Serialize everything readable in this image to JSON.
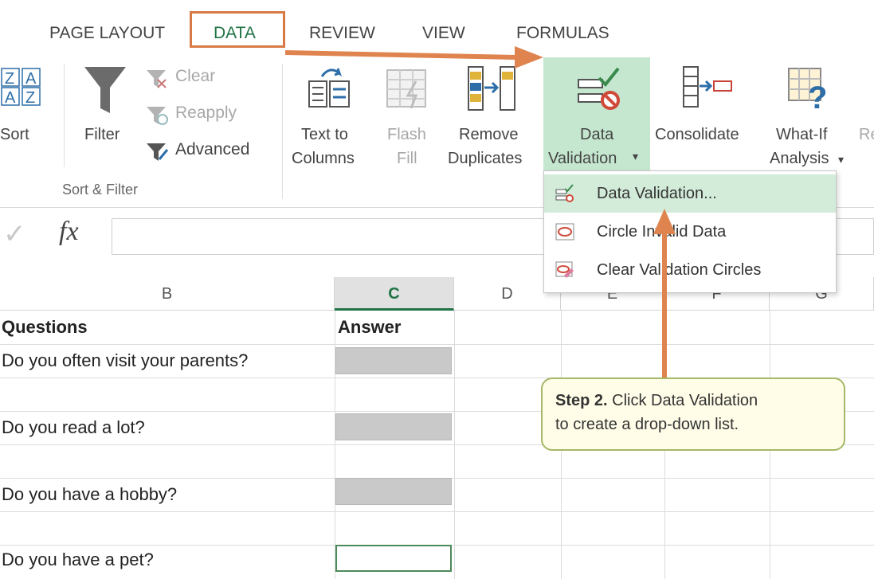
{
  "tabs": [
    "PAGE LAYOUT",
    "DATA",
    "REVIEW",
    "VIEW",
    "FORMULAS"
  ],
  "ribbon": {
    "sort_label": "Sort",
    "filter_label": "Filter",
    "clear_label": "Clear",
    "reapply_label": "Reapply",
    "advanced_label": "Advanced",
    "group_sort_filter": "Sort & Filter",
    "text_to_columns_1": "Text to",
    "text_to_columns_2": "Columns",
    "flash_fill_1": "Flash",
    "flash_fill_2": "Fill",
    "remove_duplicates_1": "Remove",
    "remove_duplicates_2": "Duplicates",
    "data_validation_1": "Data",
    "data_validation_2": "Validation",
    "dropdown_caret": "▾",
    "consolidate": "Consolidate",
    "what_if_1": "What-If",
    "what_if_2": "Analysis",
    "cut_off": "Re"
  },
  "formula_bar": {
    "fx": "fx",
    "check": "✓"
  },
  "columns": [
    "B",
    "C",
    "D",
    "E",
    "F",
    "G"
  ],
  "cells": {
    "b_header": "Questions",
    "c_header": "Answer",
    "q1": "Do you often visit your parents?",
    "q2": "Do you read a lot?",
    "q3": "Do you have a hobby?",
    "q4": "Do you have a pet?"
  },
  "dropdown": {
    "items": [
      "Data Validation...",
      "Circle Invalid Data",
      "Clear Validation Circles"
    ]
  },
  "callout": {
    "step": "Step 2.",
    "text1": " Click Data Validation",
    "text2": "to create a drop-down list."
  },
  "colors": {
    "accent": "#217346",
    "highlight": "#d87a44",
    "arrow": "#e0844f"
  }
}
